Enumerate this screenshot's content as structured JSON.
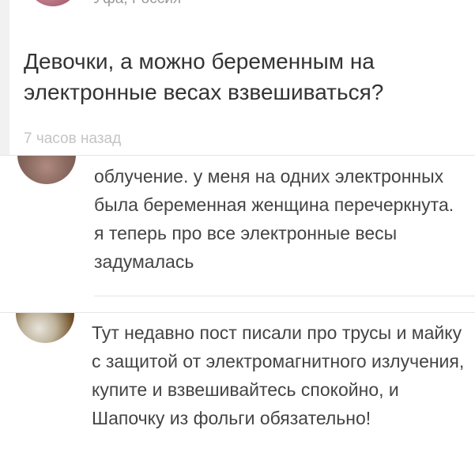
{
  "post": {
    "location": "Уфа, Россия",
    "text": "Девочки, а можно беременным на электронные весах взвешиваться?",
    "time": "7 часов назад"
  },
  "comments": [
    {
      "text": "облучение. у меня на одних электронных была беременная женщина перечеркнута. я теперь про все электронные весы задумалась"
    },
    {
      "text": "Тут недавно пост писали про трусы и майку с защитой от электромагнитного излучения, купите и взвешивайтесь спокойно, и Шапочку из фольги обязательно!"
    }
  ]
}
